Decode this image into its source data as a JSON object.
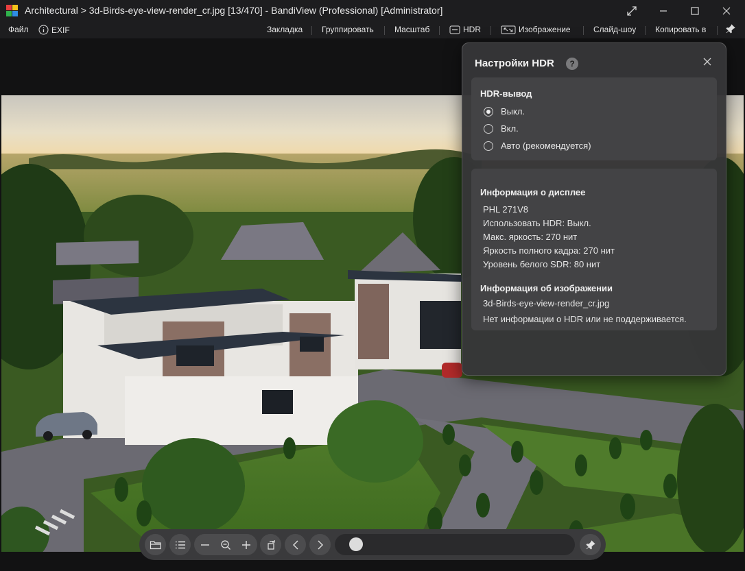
{
  "window": {
    "title": "Architectural > 3d-Birds-eye-view-render_cr.jpg [13/470] - BandiView (Professional) [Administrator]",
    "logo_colors": [
      "#e83f3f",
      "#f5c21b",
      "#2fb24d",
      "#2f8de4"
    ]
  },
  "menu": {
    "file": "Файл",
    "exif": "EXIF",
    "bookmark": "Закладка",
    "group": "Группировать",
    "scale": "Масштаб",
    "hdr": "HDR",
    "image": "Изображение",
    "slideshow": "Слайд-шоу",
    "copy_to": "Копировать в"
  },
  "hdr_panel": {
    "title": "Настройки HDR",
    "help": "?",
    "output": {
      "heading": "HDR-вывод",
      "options": [
        {
          "label": "Выкл.",
          "selected": true
        },
        {
          "label": "Вкл.",
          "selected": false
        },
        {
          "label": "Авто (рекомендуется)",
          "selected": false
        }
      ]
    },
    "display_info": {
      "heading": "Информация о дисплее",
      "lines": [
        "PHL 271V8",
        "Использовать HDR: Выкл.",
        "Макс. яркость: 270 нит",
        "Яркость полного кадра: 270 нит",
        "Уровень белого SDR: 80 нит"
      ]
    },
    "image_info": {
      "heading": "Информация об изображении",
      "lines": [
        "3d-Birds-eye-view-render_cr.jpg",
        "Нет информации о HDR или не поддерживается."
      ]
    }
  },
  "toolbar": {
    "icons": [
      "folder-icon",
      "list-icon",
      "zoom-out-icon",
      "zoom-fit-icon",
      "zoom-in-icon",
      "rotate-icon",
      "prev-icon",
      "next-icon",
      "pin-icon"
    ],
    "position_fraction": 0.03
  }
}
